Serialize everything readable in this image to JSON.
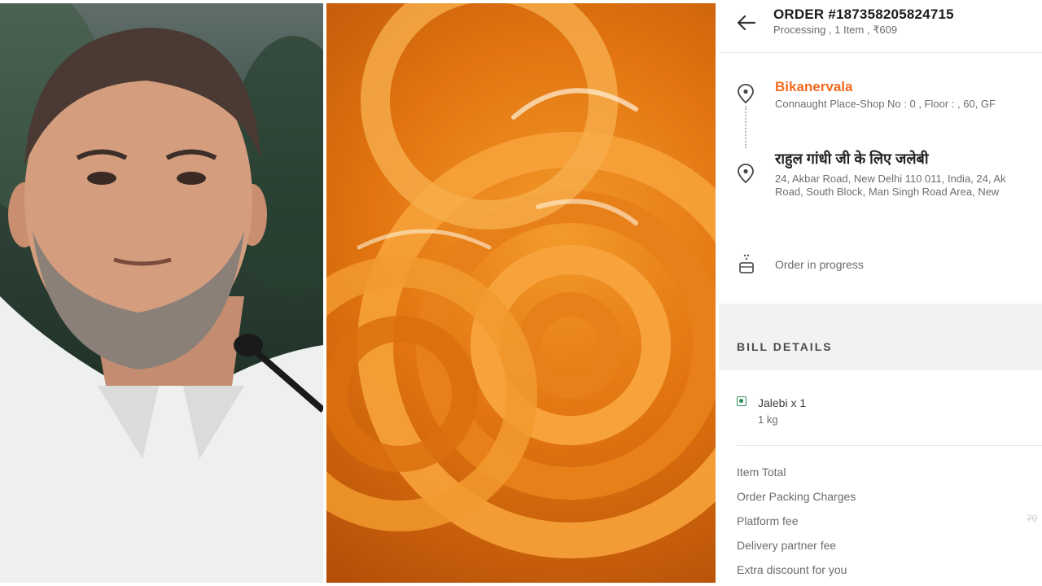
{
  "order": {
    "title": "ORDER #187358205824715",
    "subtitle": "Processing , 1 Item , ₹609"
  },
  "restaurant": {
    "name": "Bikanervala",
    "address": "Connaught Place-Shop No : 0 , Floor : , 60, GF"
  },
  "delivery": {
    "name": "राहुल गांधी जी के लिए जलेबी",
    "address_line1": "24, Akbar Road, New Delhi 110 011, India, 24, Ak",
    "address_line2": "Road, South Block, Man Singh Road Area, New"
  },
  "status": {
    "text": "Order in progress"
  },
  "bill": {
    "title": "BILL DETAILS",
    "item": {
      "name": "Jalebi x 1",
      "quantity": "1 kg"
    },
    "rows": [
      "Item Total",
      "Order Packing Charges",
      "Platform fee",
      "Delivery partner fee",
      "Extra discount for you"
    ],
    "strikethrough_value": "70"
  },
  "colors": {
    "accent": "#f26b21",
    "veg": "#2e8b57"
  },
  "icons": [
    "back-arrow-icon",
    "location-pin-icon",
    "order-status-icon",
    "veg-indicator-icon"
  ]
}
